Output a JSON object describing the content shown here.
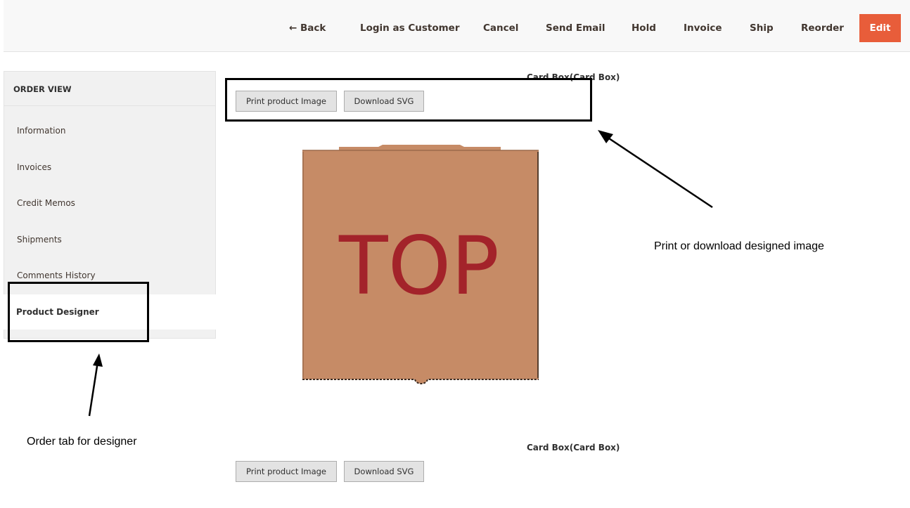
{
  "toolbar": {
    "back_label": "← Back",
    "login_label": "Login as Customer",
    "cancel_label": "Cancel",
    "send_email_label": "Send Email",
    "hold_label": "Hold",
    "invoice_label": "Invoice",
    "ship_label": "Ship",
    "reorder_label": "Reorder",
    "edit_label": "Edit",
    "edit_color": "#e85d3a"
  },
  "sidebar": {
    "title": "ORDER VIEW",
    "items": [
      {
        "label": "Information"
      },
      {
        "label": "Invoices"
      },
      {
        "label": "Credit Memos"
      },
      {
        "label": "Shipments"
      },
      {
        "label": "Comments History"
      }
    ],
    "active_item": "Product Designer"
  },
  "items": [
    {
      "title": "Card Box(Card Box)",
      "print_label": "Print product Image",
      "download_label": "Download SVG",
      "image_text": "TOP"
    },
    {
      "title": "Card Box(Card Box)",
      "print_label": "Print product Image",
      "download_label": "Download SVG"
    }
  ],
  "annotations": {
    "right_note": "Print or download designed image",
    "left_note": "Order tab for designer"
  }
}
